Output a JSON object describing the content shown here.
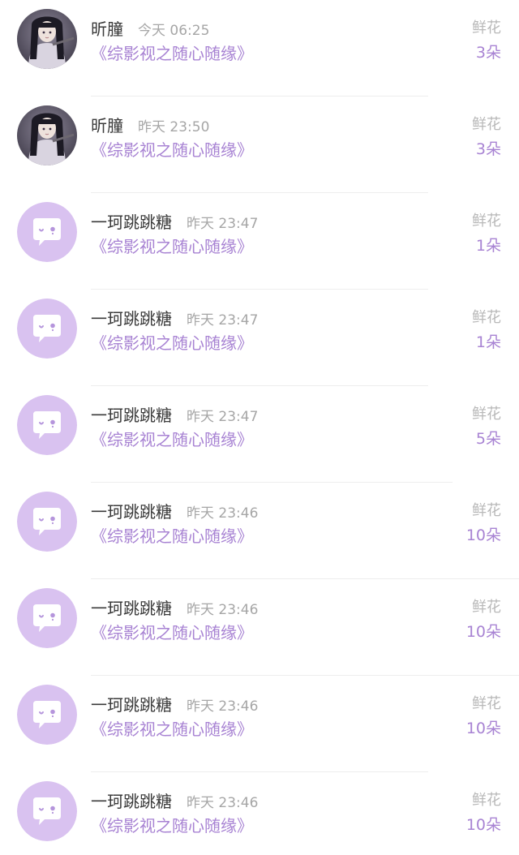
{
  "list": {
    "items": [
      {
        "avatar_type": "photo",
        "name": "昕朣",
        "time": "今天 06:25",
        "book": "《综影视之随心随缘》",
        "gift_label": "鲜花",
        "count": "3朵"
      },
      {
        "avatar_type": "photo",
        "name": "昕朣",
        "time": "昨天 23:50",
        "book": "《综影视之随心随缘》",
        "gift_label": "鲜花",
        "count": "3朵"
      },
      {
        "avatar_type": "default",
        "name": "一珂跳跳糖",
        "time": "昨天 23:47",
        "book": "《综影视之随心随缘》",
        "gift_label": "鲜花",
        "count": "1朵"
      },
      {
        "avatar_type": "default",
        "name": "一珂跳跳糖",
        "time": "昨天 23:47",
        "book": "《综影视之随心随缘》",
        "gift_label": "鲜花",
        "count": "1朵"
      },
      {
        "avatar_type": "default",
        "name": "一珂跳跳糖",
        "time": "昨天 23:47",
        "book": "《综影视之随心随缘》",
        "gift_label": "鲜花",
        "count": "5朵"
      },
      {
        "avatar_type": "default",
        "name": "一珂跳跳糖",
        "time": "昨天 23:46",
        "book": "《综影视之随心随缘》",
        "gift_label": "鲜花",
        "count": "10朵"
      },
      {
        "avatar_type": "default",
        "name": "一珂跳跳糖",
        "time": "昨天 23:46",
        "book": "《综影视之随心随缘》",
        "gift_label": "鲜花",
        "count": "10朵"
      },
      {
        "avatar_type": "default",
        "name": "一珂跳跳糖",
        "time": "昨天 23:46",
        "book": "《综影视之随心随缘》",
        "gift_label": "鲜花",
        "count": "10朵"
      },
      {
        "avatar_type": "default",
        "name": "一珂跳跳糖",
        "time": "昨天 23:46",
        "book": "《综影视之随心随缘》",
        "gift_label": "鲜花",
        "count": "10朵"
      }
    ]
  },
  "colors": {
    "accent": "#a883d3",
    "default_avatar_bg": "#d9c2f0",
    "name_text": "#3a3a3a",
    "muted_text": "#a6a6a6",
    "divider": "#ededed"
  },
  "icons": {
    "photo_avatar": "user-photo-avatar-icon",
    "default_avatar": "speech-bubble-face-icon"
  }
}
